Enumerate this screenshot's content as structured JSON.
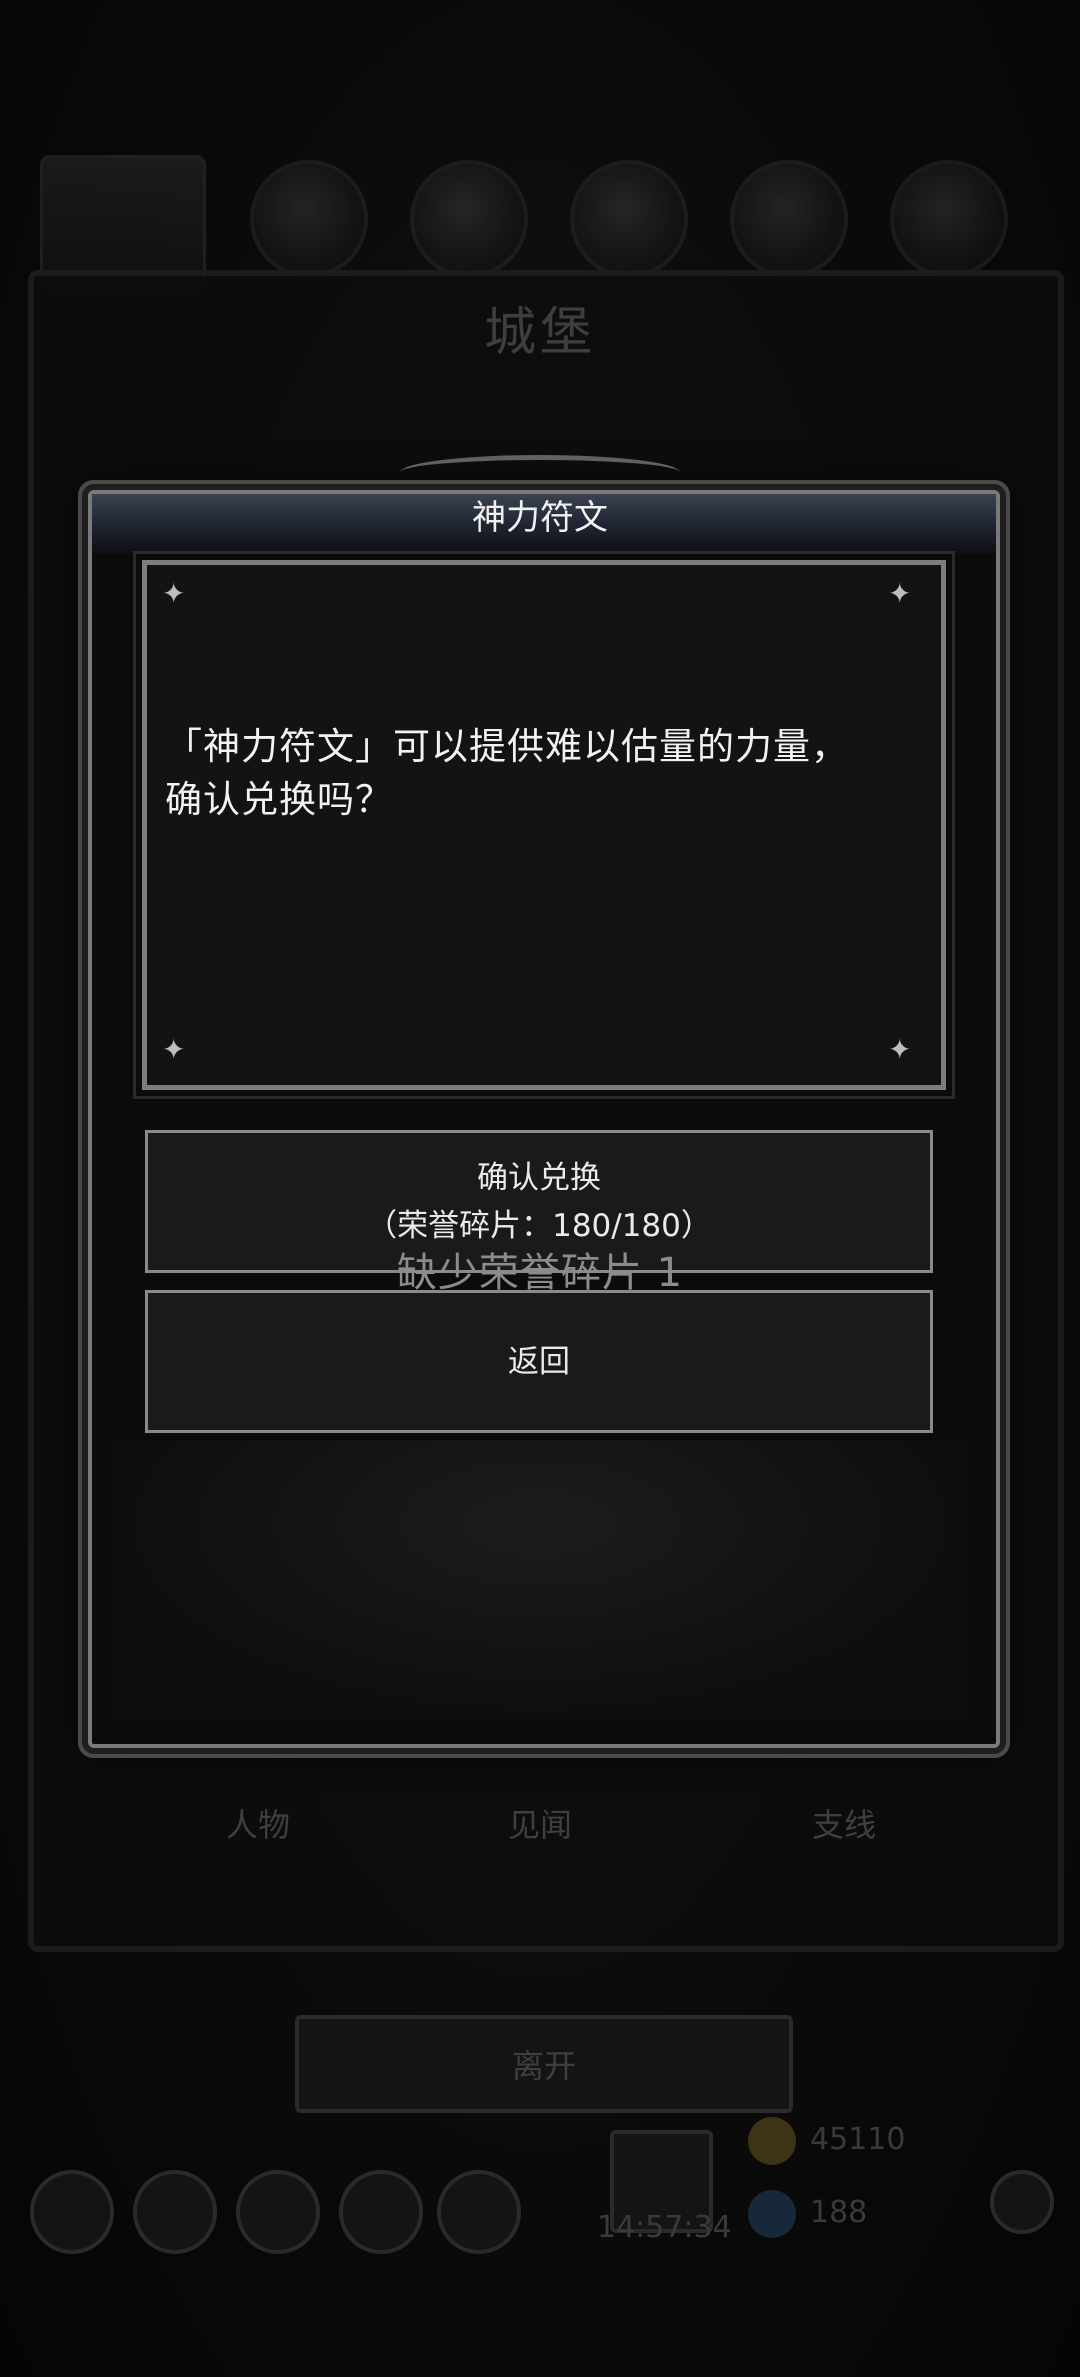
{
  "background": {
    "castle_title": "城堡",
    "tabs": [
      "人物",
      "见闻",
      "支线"
    ],
    "leave_label": "离开",
    "clock": "14:57:34",
    "gold": "45110",
    "gems": "188"
  },
  "dialog": {
    "title": "神力符文",
    "message_line1": "「神力符文」可以提供难以估量的力量，",
    "message_line2": "确认兑换吗？",
    "confirm_label": "确认兑换",
    "confirm_cost": "（荣誉碎片：180/180）",
    "shortage_notice": "缺少荣誉碎片 1",
    "back_label": "返回"
  },
  "colors": {
    "panel_border": "#7d7d7d",
    "text": "#f2f2f2",
    "dim_text": "#3f3f3f"
  }
}
